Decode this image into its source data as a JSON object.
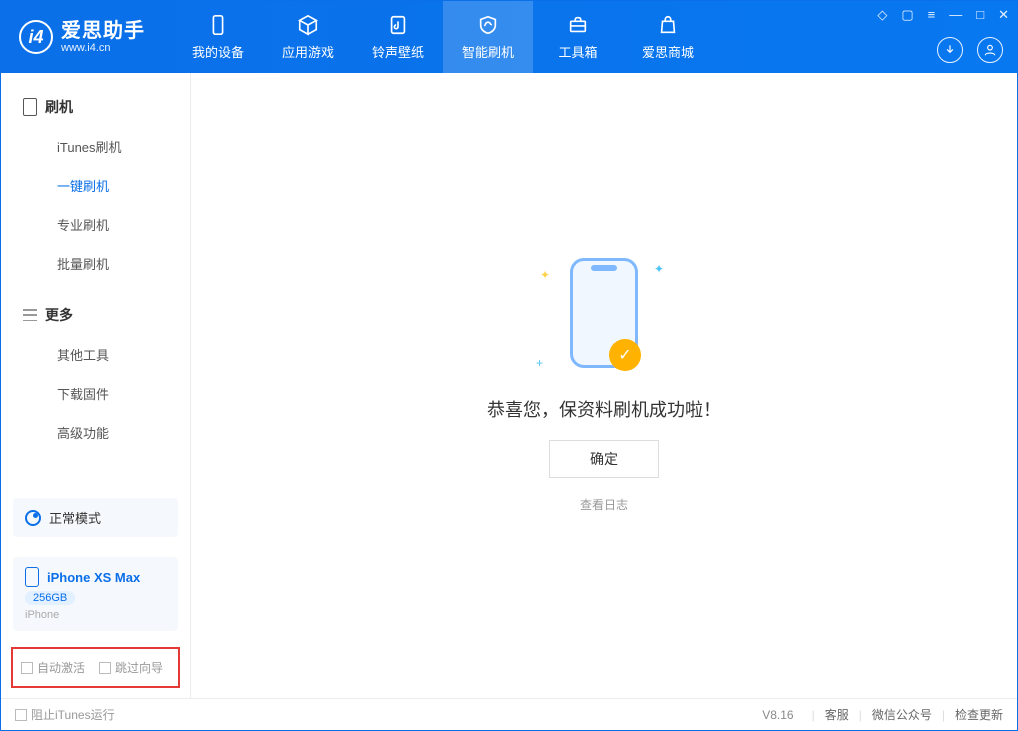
{
  "app": {
    "title": "爱思助手",
    "subtitle": "www.i4.cn"
  },
  "nav": [
    {
      "label": "我的设备"
    },
    {
      "label": "应用游戏"
    },
    {
      "label": "铃声壁纸"
    },
    {
      "label": "智能刷机"
    },
    {
      "label": "工具箱"
    },
    {
      "label": "爱思商城"
    }
  ],
  "sidebar": {
    "group1": {
      "title": "刷机",
      "items": [
        "iTunes刷机",
        "一键刷机",
        "专业刷机",
        "批量刷机"
      ]
    },
    "group2": {
      "title": "更多",
      "items": [
        "其他工具",
        "下载固件",
        "高级功能"
      ]
    }
  },
  "mode": {
    "label": "正常模式"
  },
  "device": {
    "name": "iPhone XS Max",
    "capacity": "256GB",
    "type": "iPhone"
  },
  "options": {
    "auto_activate": "自动激活",
    "skip_guide": "跳过向导"
  },
  "main": {
    "message": "恭喜您，保资料刷机成功啦！",
    "confirm": "确定",
    "view_log": "查看日志"
  },
  "footer": {
    "block_itunes": "阻止iTunes运行",
    "version": "V8.16",
    "links": [
      "客服",
      "微信公众号",
      "检查更新"
    ]
  }
}
